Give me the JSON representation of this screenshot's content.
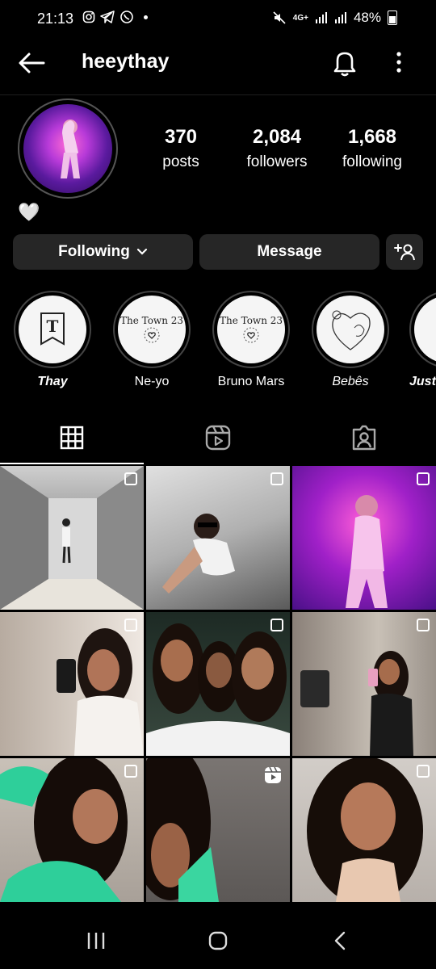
{
  "status": {
    "time": "21:13",
    "network": "4G+",
    "battery": "48%"
  },
  "header": {
    "username": "heeythay"
  },
  "profile": {
    "bio_emoji": "🤍",
    "stats": [
      {
        "value": "370",
        "label": "posts"
      },
      {
        "value": "2,084",
        "label": "followers"
      },
      {
        "value": "1,668",
        "label": "following"
      }
    ]
  },
  "actions": {
    "following": "Following",
    "message": "Message"
  },
  "highlights": [
    {
      "label": "Thay",
      "cover": "T"
    },
    {
      "label": "Ne-yo",
      "cover": "The Town 23"
    },
    {
      "label": "Bruno Mars",
      "cover": "The Town 23"
    },
    {
      "label": "Bebês",
      "cover": ""
    },
    {
      "label": "Just",
      "cover": ""
    }
  ],
  "tabs": [
    "grid-icon",
    "reels-icon",
    "tagged-icon"
  ],
  "grid_posts": [
    {
      "type": "carousel"
    },
    {
      "type": "carousel"
    },
    {
      "type": "carousel"
    },
    {
      "type": "carousel"
    },
    {
      "type": "carousel"
    },
    {
      "type": "carousel"
    },
    {
      "type": "carousel"
    },
    {
      "type": "reel"
    },
    {
      "type": "carousel"
    }
  ],
  "colors": {
    "background": "#000000",
    "button": "#262626"
  }
}
